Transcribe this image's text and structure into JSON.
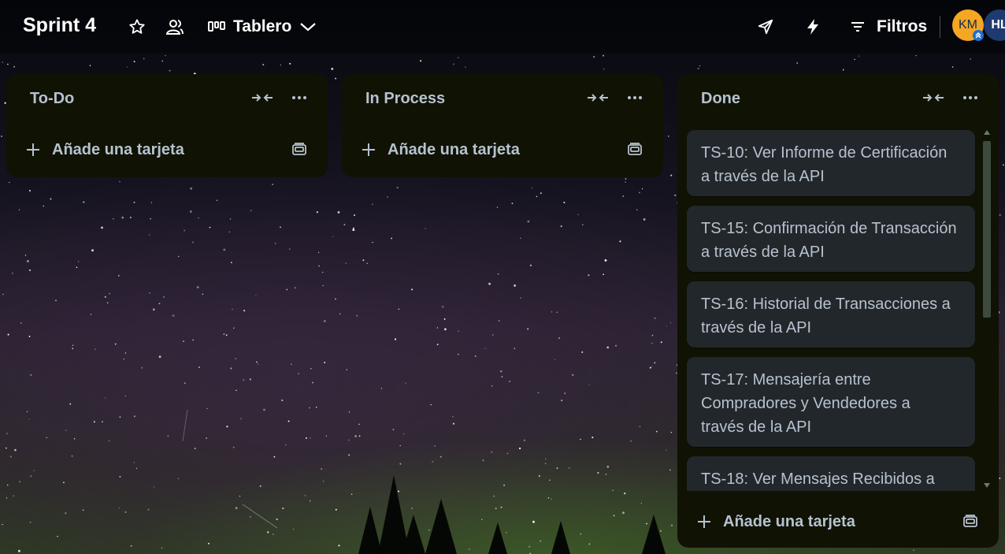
{
  "header": {
    "board_title": "Sprint 4",
    "view_label": "Tablero",
    "filters_label": "Filtros",
    "icons": [
      "star-icon",
      "workspace-visibility-icon",
      "board-view-icon",
      "chevron-down-icon",
      "power-ups-icon",
      "automation-icon",
      "filter-icon"
    ],
    "members": [
      {
        "initials": "KM",
        "color": "#f5a623",
        "badge": "admin-chevron-icon"
      },
      {
        "initials": "HL",
        "color": "#1f3a6e"
      }
    ]
  },
  "lists": [
    {
      "title": "To-Do",
      "add_card_label": "Añade una tarjeta",
      "cards": []
    },
    {
      "title": "In Process",
      "add_card_label": "Añade una tarjeta",
      "cards": []
    },
    {
      "title": "Done",
      "add_card_label": "Añade una tarjeta",
      "cards": [
        {
          "line1": "TS-10: Ver Informe de Certificación",
          "line2": "a través de la API"
        },
        {
          "line1": "TS-15: Confirmación de Transacción",
          "line2": "a través de la API"
        },
        {
          "line1": "TS-16: Historial de Transacciones a",
          "line2": "través de la API"
        },
        {
          "line1": "TS-17: Mensajería entre",
          "line2": "Compradores y Vendedores a",
          "line3": "través de la API"
        },
        {
          "line1": "TS-18: Ver Mensajes Recibidos a",
          "line2": ""
        }
      ]
    }
  ],
  "colors": {
    "list_bg": "#101204",
    "card_bg": "#22272b",
    "text": "#b6c2cf",
    "header_text": "#ffffff"
  }
}
